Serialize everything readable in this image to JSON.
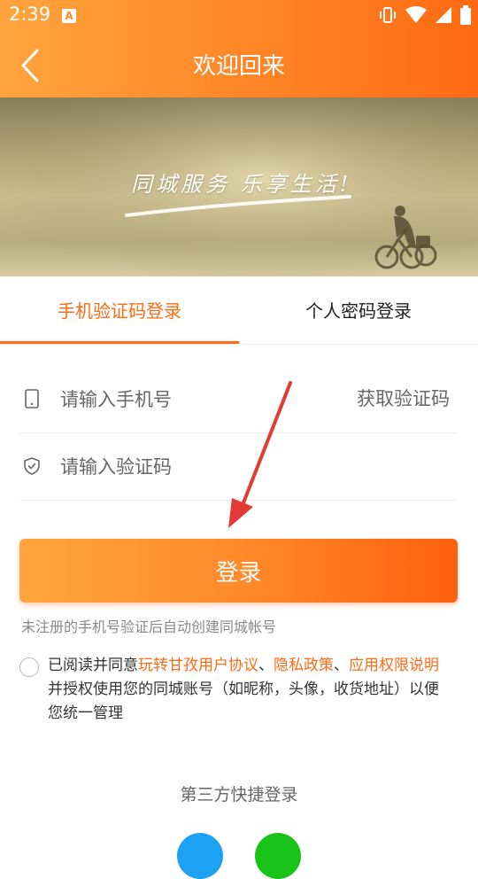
{
  "status_bar": {
    "time": "2:39",
    "badge": "A"
  },
  "nav": {
    "title": "欢迎回来"
  },
  "banner": {
    "slogan": "同城服务 乐享生活!"
  },
  "tabs": [
    {
      "label": "手机验证码登录",
      "active": true
    },
    {
      "label": "个人密码登录",
      "active": false
    }
  ],
  "form": {
    "phone_placeholder": "请输入手机号",
    "code_placeholder": "请输入验证码",
    "get_code_label": "获取验证码",
    "login_label": "登录",
    "hint": "未注册的手机号验证后自动创建同城帐号"
  },
  "agreement": {
    "prefix": "已阅读并同意",
    "link1": "玩转甘孜用户协议",
    "sep1": "、",
    "link2": "隐私政策",
    "sep2": "、",
    "link3": "应用权限说明",
    "suffix": "并授权使用您的同城账号（如昵称，头像，收货地址）以便您统一管理"
  },
  "third_party": {
    "title": "第三方快捷登录"
  },
  "colors": {
    "accent": "#ff6a12",
    "gradient_start": "#ffa53e",
    "qq": "#1da1f2",
    "wechat": "#18c318",
    "annotation_arrow": "#e53935"
  }
}
